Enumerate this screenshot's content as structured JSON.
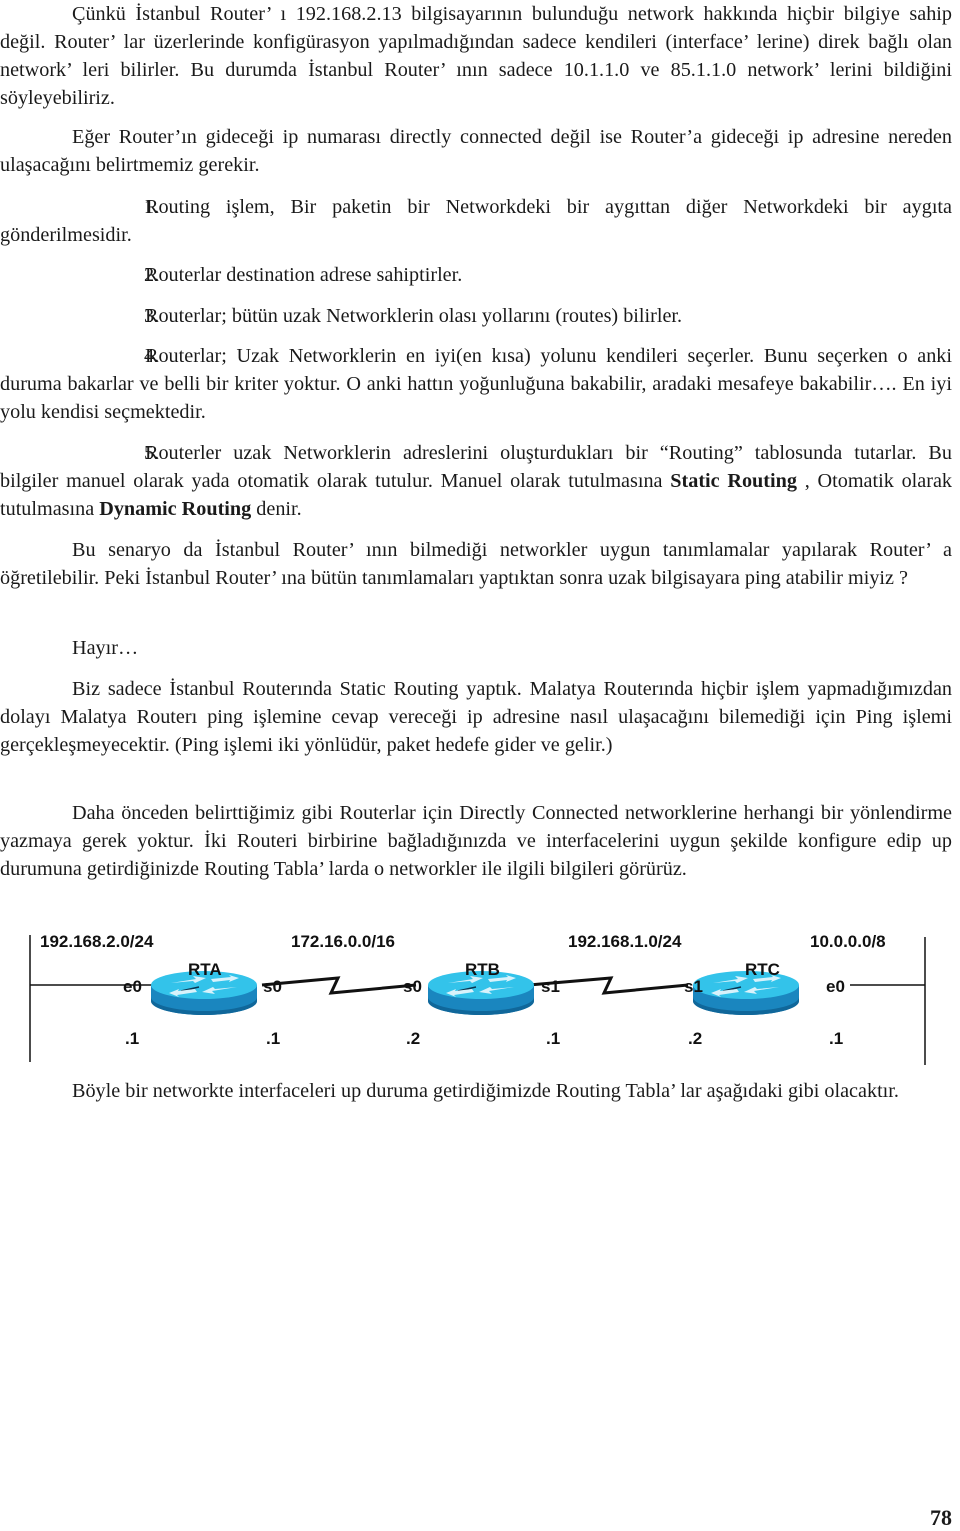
{
  "paragraphs": {
    "p1": "Çünkü İstanbul Router’ ı 192.168.2.13 bilgisayarının bulunduğu network hakkında hiçbir bilgiye sahip değil. Router’ lar üzerlerinde konfigürasyon yapılmadığından sadece kendileri (interface’ lerine) direk bağlı olan network’ leri bilirler. Bu durumda İstanbul Router’ ının sadece 10.1.1.0 ve 85.1.1.0 network’ lerini bildiğini söyleyebiliriz.",
    "p2": "Eğer Router’ın gideceği ip numarası directly connected değil ise Router’a gideceği ip adresine nereden ulaşacağını belirtmemiz gerekir.",
    "p3": "Bu senaryo da İstanbul Router’ ının bilmediği networkler uygun tanımlamalar yapılarak Router’ a öğretilebilir. Peki İstanbul Router’ ına bütün tanımlamaları yaptıktan sonra uzak bilgisayara ping atabilir miyiz ?",
    "p4": "Hayır…",
    "p5": "Biz sadece İstanbul Routerında Static Routing yaptık. Malatya Routerında hiçbir işlem yapmadığımızdan dolayı Malatya Routerı ping işlemine cevap vereceği ip adresine nasıl ulaşacağını bilemediği için Ping işlemi gerçekleşmeyecektir. (Ping işlemi iki yönlüdür, paket hedefe gider ve gelir.)",
    "p6": "Daha önceden belirttiğimiz gibi Routerlar için Directly Connected networklerine herhangi bir yönlendirme yazmaya gerek yoktur. İki Routeri birbirine bağladığınızda ve interfacelerini uygun şekilde konfigure edip up durumuna getirdiğinizde Routing Tabla’ larda o networkler ile ilgili bilgileri görürüz.",
    "p7": "Böyle bir networkte interfaceleri up duruma getirdiğimizde Routing Tabla’ lar aşağıdaki gibi olacaktır."
  },
  "list": [
    {
      "num": "1.",
      "text": "Routing işlem, Bir paketin bir Networkdeki bir aygıttan diğer Networkdeki bir aygıta gönderilmesidir."
    },
    {
      "num": "2.",
      "text": "Routerlar destination adrese sahiptirler."
    },
    {
      "num": "3.",
      "text": "Routerlar; bütün uzak Networklerin olası yollarını (routes) bilirler."
    },
    {
      "num": "4.",
      "text": "Routerlar; Uzak Networklerin en iyi(en kısa) yolunu kendileri seçerler. Bunu seçerken o anki duruma bakarlar ve belli bir kriter yoktur. O anki hattın yoğunluğuna bakabilir, aradaki mesafeye bakabilir…. En iyi yolu kendisi seçmektedir."
    },
    {
      "num": "5.",
      "text_before": "Routerler uzak Networklerin adreslerini oluşturdukları bir “Routing” tablosunda tutarlar. Bu bilgiler manuel olarak yada otomatik olarak tutulur. Manuel olarak tutulmasına ",
      "bold1": "Static Routing",
      "text_middle": " , Otomatik olarak tutulmasına ",
      "bold2": "Dynamic Routing",
      "text_after": " denir."
    }
  ],
  "diagram": {
    "networks": [
      "192.168.2.0/24",
      "172.16.0.0/16",
      "192.168.1.0/24",
      "10.0.0.0/8"
    ],
    "routers": [
      {
        "name": "RTA",
        "left_if": "e0",
        "right_if": "s0",
        "left_addr": ".1",
        "right_addr": ".1"
      },
      {
        "name": "RTB",
        "left_if": "s0",
        "right_if": "s1",
        "left_addr": ".2",
        "right_addr": ".1"
      },
      {
        "name": "RTC",
        "left_if": "s1",
        "right_if": "e0",
        "left_addr": ".2",
        "right_addr": ".1"
      }
    ],
    "colors": {
      "router_top": "#33c3ea",
      "router_side": "#1a86bf",
      "router_side_dark": "#10679a",
      "router_glyph": "#d8f2fb"
    }
  },
  "page_number": "78"
}
